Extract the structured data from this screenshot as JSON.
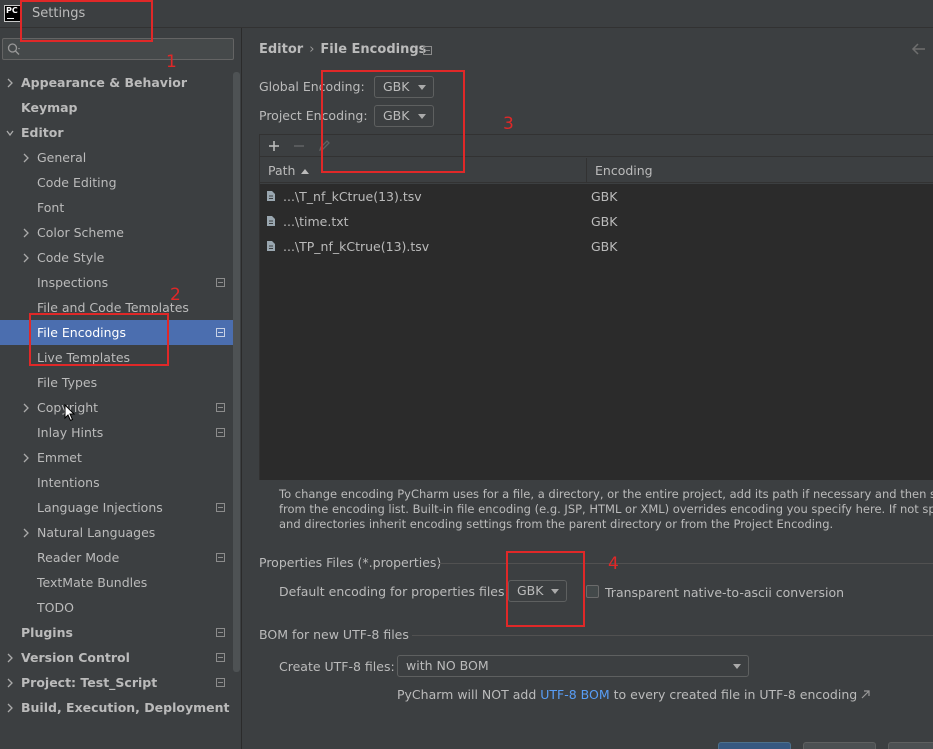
{
  "window": {
    "title": "Settings",
    "app_icon": "PC"
  },
  "search": {
    "placeholder": "",
    "icon": "search-icon"
  },
  "sidebar": {
    "items": [
      {
        "label": "Appearance & Behavior",
        "bold": true,
        "arrow": true,
        "level": 0
      },
      {
        "label": "Keymap",
        "bold": true,
        "arrow": false,
        "level": 0
      },
      {
        "label": "Editor",
        "bold": true,
        "arrow": "open",
        "level": 0
      },
      {
        "label": "General",
        "arrow": true,
        "level": 1
      },
      {
        "label": "Code Editing",
        "level": 1
      },
      {
        "label": "Font",
        "level": 1
      },
      {
        "label": "Color Scheme",
        "arrow": true,
        "level": 1
      },
      {
        "label": "Code Style",
        "arrow": true,
        "level": 1
      },
      {
        "label": "Inspections",
        "level": 1,
        "project": true
      },
      {
        "label": "File and Code Templates",
        "level": 1
      },
      {
        "label": "File Encodings",
        "level": 1,
        "project": true,
        "selected": true
      },
      {
        "label": "Live Templates",
        "level": 1
      },
      {
        "label": "File Types",
        "level": 1
      },
      {
        "label": "Copyright",
        "arrow": true,
        "level": 1,
        "project": true
      },
      {
        "label": "Inlay Hints",
        "level": 1,
        "project": true
      },
      {
        "label": "Emmet",
        "arrow": true,
        "level": 1
      },
      {
        "label": "Intentions",
        "level": 1
      },
      {
        "label": "Language Injections",
        "level": 1,
        "project": true
      },
      {
        "label": "Natural Languages",
        "arrow": true,
        "level": 1
      },
      {
        "label": "Reader Mode",
        "level": 1,
        "project": true
      },
      {
        "label": "TextMate Bundles",
        "level": 1
      },
      {
        "label": "TODO",
        "level": 1
      },
      {
        "label": "Plugins",
        "bold": true,
        "level": 0,
        "project": true
      },
      {
        "label": "Version Control",
        "bold": true,
        "arrow": true,
        "level": 0,
        "project": true
      },
      {
        "label": "Project: Test_Script",
        "bold": true,
        "arrow": true,
        "level": 0,
        "project": true
      },
      {
        "label": "Build, Execution, Deployment",
        "bold": true,
        "arrow": true,
        "level": 0
      }
    ]
  },
  "breadcrumb": {
    "parent": "Editor",
    "current": "File Encodings"
  },
  "encodings": {
    "global_label": "Global Encoding:",
    "global_value": "GBK",
    "project_label": "Project Encoding:",
    "project_value": "GBK"
  },
  "table": {
    "columns": [
      "Path",
      "Encoding"
    ],
    "rows": [
      {
        "path": "...\\T_nf_kCtrue(13).tsv",
        "encoding": "GBK"
      },
      {
        "path": "...\\time.txt",
        "encoding": "GBK"
      },
      {
        "path": "...\\TP_nf_kCtrue(13).tsv",
        "encoding": "GBK"
      }
    ]
  },
  "help": {
    "line1": "To change encoding PyCharm uses for a file, a directory, or the entire project, add its path if necessary and then select encod",
    "line2": "from the encoding list. Built-in file encoding (e.g. JSP, HTML or XML) overrides encoding you specify here. If not specified, fil",
    "line3": "and directories inherit encoding settings from the parent directory or from the Project Encoding."
  },
  "properties": {
    "section_title": "Properties Files (*.properties)",
    "default_label": "Default encoding for properties files:",
    "default_value": "GBK",
    "transparent_label": "Transparent native-to-ascii conversion",
    "transparent_checked": false
  },
  "bom": {
    "section_title": "BOM for new UTF-8 files",
    "create_label": "Create UTF-8 files:",
    "create_value": "with NO BOM",
    "note_prefix": "PyCharm will NOT add ",
    "note_link": "UTF-8 BOM",
    "note_suffix": " to every created file in UTF-8 encoding"
  },
  "annotations": [
    "1",
    "2",
    "3",
    "4"
  ],
  "colors": {
    "selection": "#4b6eaf",
    "link": "#589df6",
    "annotation": "#e02828",
    "background": "#3c3f41",
    "table_bg": "#2b2b2b"
  }
}
